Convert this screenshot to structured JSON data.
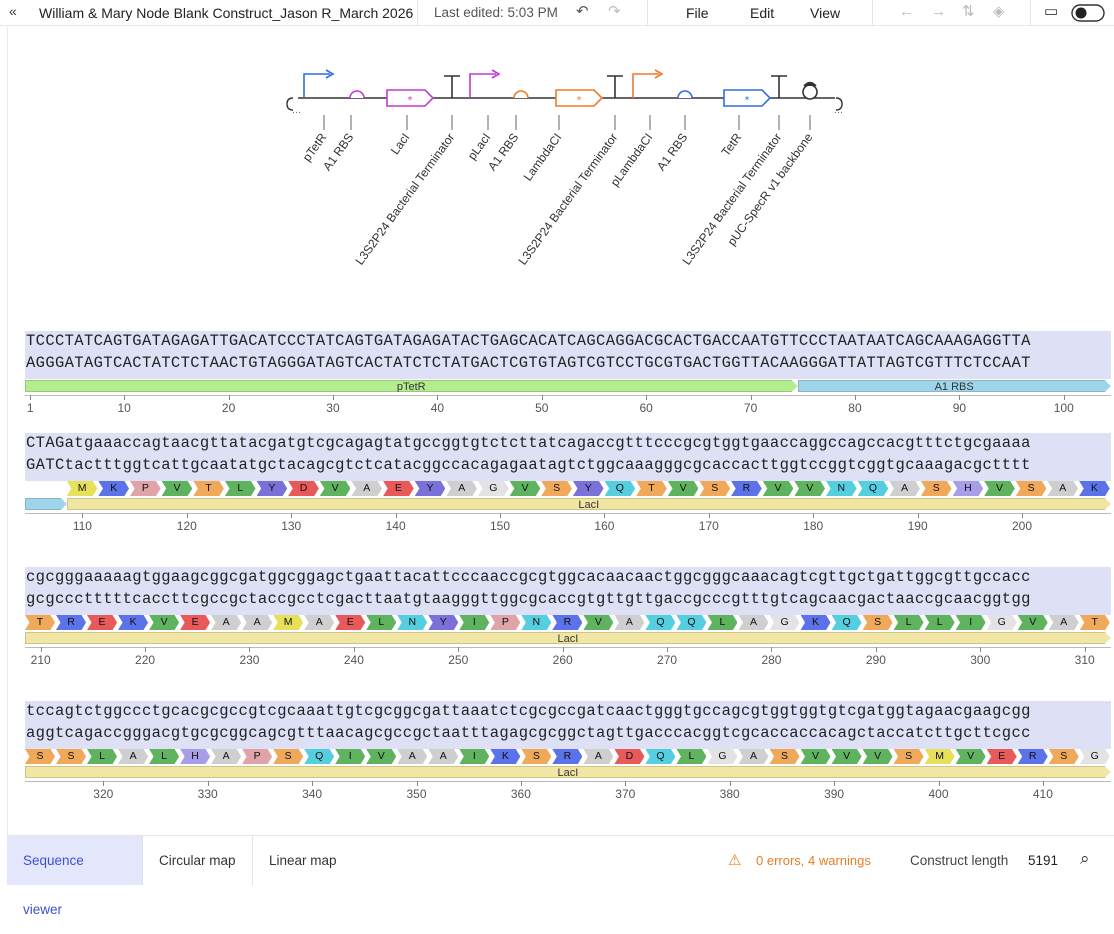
{
  "toolbar": {
    "collapse_icon": "double-chevron-left-icon",
    "doc_title": "William & Mary Node Blank Construct_Jason R_March 2026",
    "last_edited": "Last edited: 5:03 PM",
    "menu": [
      "File",
      "Edit",
      "View"
    ]
  },
  "map": {
    "features": [
      {
        "name": "pTetR",
        "kind": "promoter",
        "color": "#2f6fe0"
      },
      {
        "name": "A1 RBS",
        "kind": "rbs",
        "color": "#c03ad0"
      },
      {
        "name": "LacI",
        "kind": "cds",
        "color": "#c03ad0"
      },
      {
        "name": "L3S2P24 Bacterial Terminator",
        "kind": "terminator",
        "color": "#333333"
      },
      {
        "name": "pLacI",
        "kind": "promoter",
        "color": "#c03ad0"
      },
      {
        "name": "A1 RBS",
        "kind": "rbs",
        "color": "#ef7a2a"
      },
      {
        "name": "LambdaCI",
        "kind": "cds",
        "color": "#ef7a2a"
      },
      {
        "name": "L3S2P24 Bacterial Terminator",
        "kind": "terminator",
        "color": "#333333"
      },
      {
        "name": "pLambdaCI",
        "kind": "promoter",
        "color": "#ef7a2a"
      },
      {
        "name": "A1 RBS",
        "kind": "rbs",
        "color": "#2f6fe0"
      },
      {
        "name": "TetR",
        "kind": "cds",
        "color": "#2f6fe0"
      },
      {
        "name": "L3S2P24 Bacterial Terminator",
        "kind": "terminator",
        "color": "#333333"
      },
      {
        "name": "pUC-SpecR v1 backbone",
        "kind": "origin",
        "color": "#333333"
      }
    ]
  },
  "sequence_rows": [
    {
      "top": "TCCCTATCAGTGATAGAGATTGACATCCCTATCAGTGATAGAGATACTGAGCACATCAGCAGGACGCACTGACCAATGTTCCCTAATAATCAGCAAAGAGGTTA",
      "bottom": "AGGGATAGTCACTATCTCTAACTGTAGGGATAGTCACTATCTCTATGACTCGTGTAGTCGTCCTGCGTGACTGGTTACAAGGGATTATTAGTCGTTTCTCCAAT",
      "annotations": [
        {
          "label": "pTetR",
          "color": "#b3ed8e",
          "start": 1,
          "end": 74
        },
        {
          "label": "A1 RBS",
          "color": "#9fd5ea",
          "start": 75,
          "end": 104
        }
      ],
      "ruler": [
        "1",
        "10",
        "20",
        "30",
        "40",
        "50",
        "60",
        "70",
        "80",
        "90",
        "100"
      ],
      "first": 1
    },
    {
      "top": "CTAGatgaaaccagtaacgttatacgatgtcgcagagtatgccggtgtctcttatcagaccgtttcccgcgtggtgaaccaggccagccacgtttctgcgaaaa",
      "bottom": "GATCtactttggtcattgcaatatgctacagcgtctcatacggccacagagaatagtctggcaaagggcgcaccacttggtccggtcggtgcaaagacgctttt",
      "annotations": [
        {
          "label": "",
          "color": "#9fd5ea",
          "start": 105,
          "end": 108
        },
        {
          "label": "LacI",
          "color": "#f1e6a4",
          "start": 109,
          "end": 208
        }
      ],
      "aa": [
        "M",
        "K",
        "P",
        "V",
        "T",
        "L",
        "Y",
        "D",
        "V",
        "A",
        "E",
        "Y",
        "A",
        "G",
        "V",
        "S",
        "Y",
        "Q",
        "T",
        "V",
        "S",
        "R",
        "V",
        "V",
        "N",
        "Q",
        "A",
        "S",
        "H",
        "V",
        "S",
        "A",
        "K"
      ],
      "ruler": [
        "110",
        "120",
        "130",
        "140",
        "150",
        "160",
        "170",
        "180",
        "190",
        "200"
      ],
      "first": 105
    },
    {
      "top": "cgcgggaaaaagtggaagcggcgatggcggagctgaattacattcccaaccgcgtggcacaacaactggcgggcaaacagtcgttgctgattggcgttgccacc",
      "bottom": "gcgccctttttcaccttcgccgctaccgcctcgacttaatgtaagggttggcgcaccgtgttgttgaccgcccgtttgtcagcaacgactaaccgcaacggtgg",
      "annotations": [
        {
          "label": "LacI",
          "color": "#f1e6a4",
          "start": 209,
          "end": 312
        }
      ],
      "aa": [
        "T",
        "R",
        "E",
        "K",
        "V",
        "E",
        "A",
        "A",
        "M",
        "A",
        "E",
        "L",
        "N",
        "Y",
        "I",
        "P",
        "N",
        "R",
        "V",
        "A",
        "Q",
        "Q",
        "L",
        "A",
        "G",
        "K",
        "Q",
        "S",
        "L",
        "L",
        "I",
        "G",
        "V",
        "A",
        "T"
      ],
      "ruler": [
        "210",
        "220",
        "230",
        "240",
        "250",
        "260",
        "270",
        "280",
        "290",
        "300",
        "310"
      ],
      "first": 209
    },
    {
      "top": "tccagtctggccctgcacgcgccgtcgcaaattgtcgcggcgattaaatctcgcgccgatcaactgggtgccagcgtggtggtgtcgatggtagaacgaagcgg",
      "bottom": "aggtcagaccgggacgtgcgcggcagcgtttaacagcgccgctaatttagagcgcggctagttgacccacggtcgcaccaccacagctaccatcttgcttcgcc",
      "annotations": [
        {
          "label": "LacI",
          "color": "#f1e6a4",
          "start": 313,
          "end": 416
        }
      ],
      "aa": [
        "S",
        "S",
        "L",
        "A",
        "L",
        "H",
        "A",
        "P",
        "S",
        "Q",
        "I",
        "V",
        "A",
        "A",
        "I",
        "K",
        "S",
        "R",
        "A",
        "D",
        "Q",
        "L",
        "G",
        "A",
        "S",
        "V",
        "V",
        "V",
        "S",
        "M",
        "V",
        "E",
        "R",
        "S",
        "G"
      ],
      "ruler": [
        "320",
        "330",
        "340",
        "350",
        "360",
        "370",
        "380",
        "390",
        "400",
        "410"
      ],
      "first": 313
    }
  ],
  "bottom": {
    "tabs": [
      "Sequence viewer",
      "Circular map",
      "Linear map"
    ],
    "active_tab": 0,
    "warnings": "0 errors, 4 warnings",
    "warn_color": "#e67e22",
    "length_label": "Construct length",
    "length_value": "5191"
  }
}
